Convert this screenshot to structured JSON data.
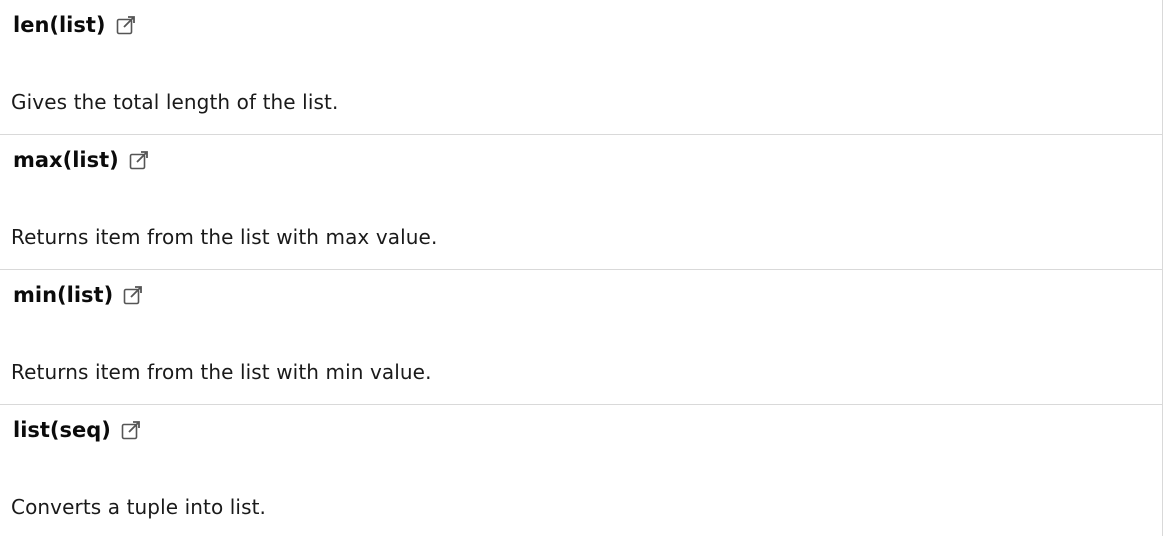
{
  "functions": [
    {
      "name": "len(list)",
      "description": "Gives the total length of the list.",
      "icon": "external-link-icon"
    },
    {
      "name": "max(list)",
      "description": "Returns item from the list with max value.",
      "icon": "external-link-icon"
    },
    {
      "name": "min(list)",
      "description": "Returns item from the list with min value.",
      "icon": "external-link-icon"
    },
    {
      "name": "list(seq)",
      "description": "Converts a tuple into list.",
      "icon": "external-link-icon"
    }
  ]
}
